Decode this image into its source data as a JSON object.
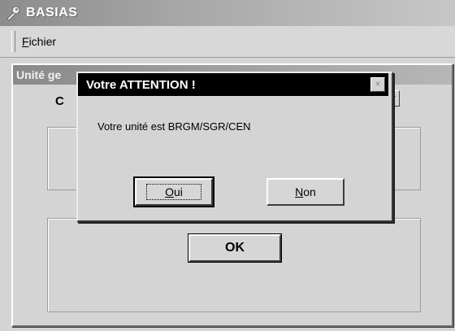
{
  "app": {
    "title": "BASIAS",
    "menu": [
      "Fichier"
    ]
  },
  "inner_window": {
    "title": "Unité ge",
    "combo_label": "C",
    "ok_label": "OK"
  },
  "dialog": {
    "title": "Votre ATTENTION !",
    "message": "Votre unité est BRGM/SGR/CEN",
    "buttons": {
      "oui": "Oui",
      "non": "Non"
    },
    "close_glyph": "×"
  },
  "icons": {
    "app_icon": "wrench-icon",
    "close_icon": "close-icon",
    "combo_icon": "chevron-down-icon"
  }
}
